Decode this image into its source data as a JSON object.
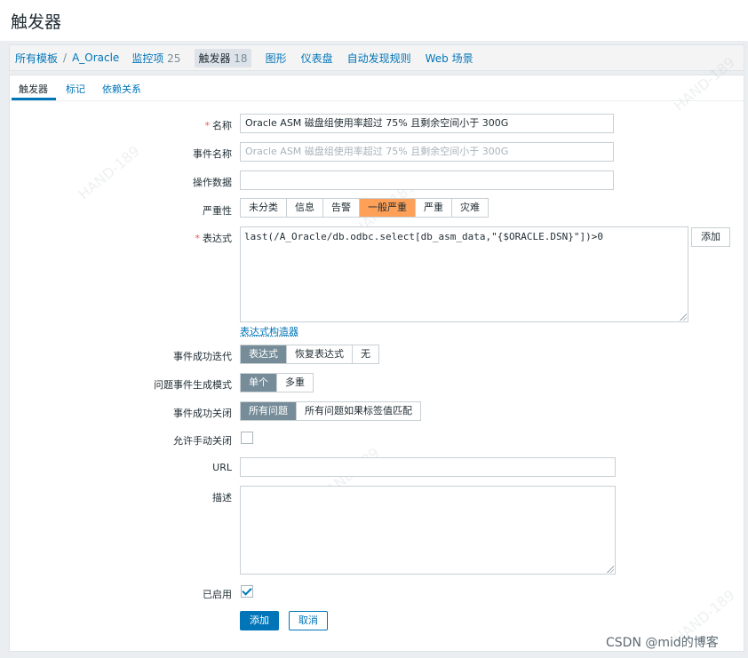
{
  "page_title": "触发器",
  "breadcrumb": {
    "all_templates": "所有模板",
    "separator": "/",
    "template": "A_Oracle",
    "items_label": "监控项",
    "items_count": "25",
    "triggers_label": "触发器",
    "triggers_count": "18",
    "graphs": "图形",
    "dashboards": "仪表盘",
    "discovery": "自动发现规则",
    "web": "Web 场景"
  },
  "tabs": [
    "触发器",
    "标记",
    "依赖关系"
  ],
  "form": {
    "name_label": "名称",
    "name_value": "Oracle ASM 磁盘组使用率超过 75% 且剩余空间小于 300G",
    "event_name_label": "事件名称",
    "event_name_placeholder": "Oracle ASM 磁盘组使用率超过 75% 且剩余空间小于 300G",
    "opdata_label": "操作数据",
    "opdata_value": "",
    "severity_label": "严重性",
    "severity_options": [
      "未分类",
      "信息",
      "告警",
      "一般严重",
      "严重",
      "灾难"
    ],
    "severity_selected": "一般严重",
    "expression_label": "表达式",
    "expression_value": "last(/A_Oracle/db.odbc.select[db_asm_data,\"{$ORACLE.DSN}\"])>0",
    "add_button": "添加",
    "expression_constructor": "表达式构造器",
    "ok_event_label": "事件成功迭代",
    "ok_event_options": [
      "表达式",
      "恢复表达式",
      "无"
    ],
    "ok_event_selected": "表达式",
    "problem_mode_label": "问题事件生成模式",
    "problem_mode_options": [
      "单个",
      "多重"
    ],
    "problem_mode_selected": "单个",
    "ok_close_label": "事件成功关闭",
    "ok_close_options": [
      "所有问题",
      "所有问题如果标签值匹配"
    ],
    "ok_close_selected": "所有问题",
    "manual_close_label": "允许手动关闭",
    "manual_close_checked": false,
    "url_label": "URL",
    "url_value": "",
    "description_label": "描述",
    "description_value": "",
    "enabled_label": "已启用",
    "enabled_checked": true,
    "submit_button": "添加",
    "cancel_button": "取消"
  },
  "watermark_text": "HAND-189",
  "credit": "CSDN @mid的博客",
  "colors": {
    "accent": "#0275b8",
    "severity_average": "#ffa059",
    "segment_selected": "#768d99"
  }
}
